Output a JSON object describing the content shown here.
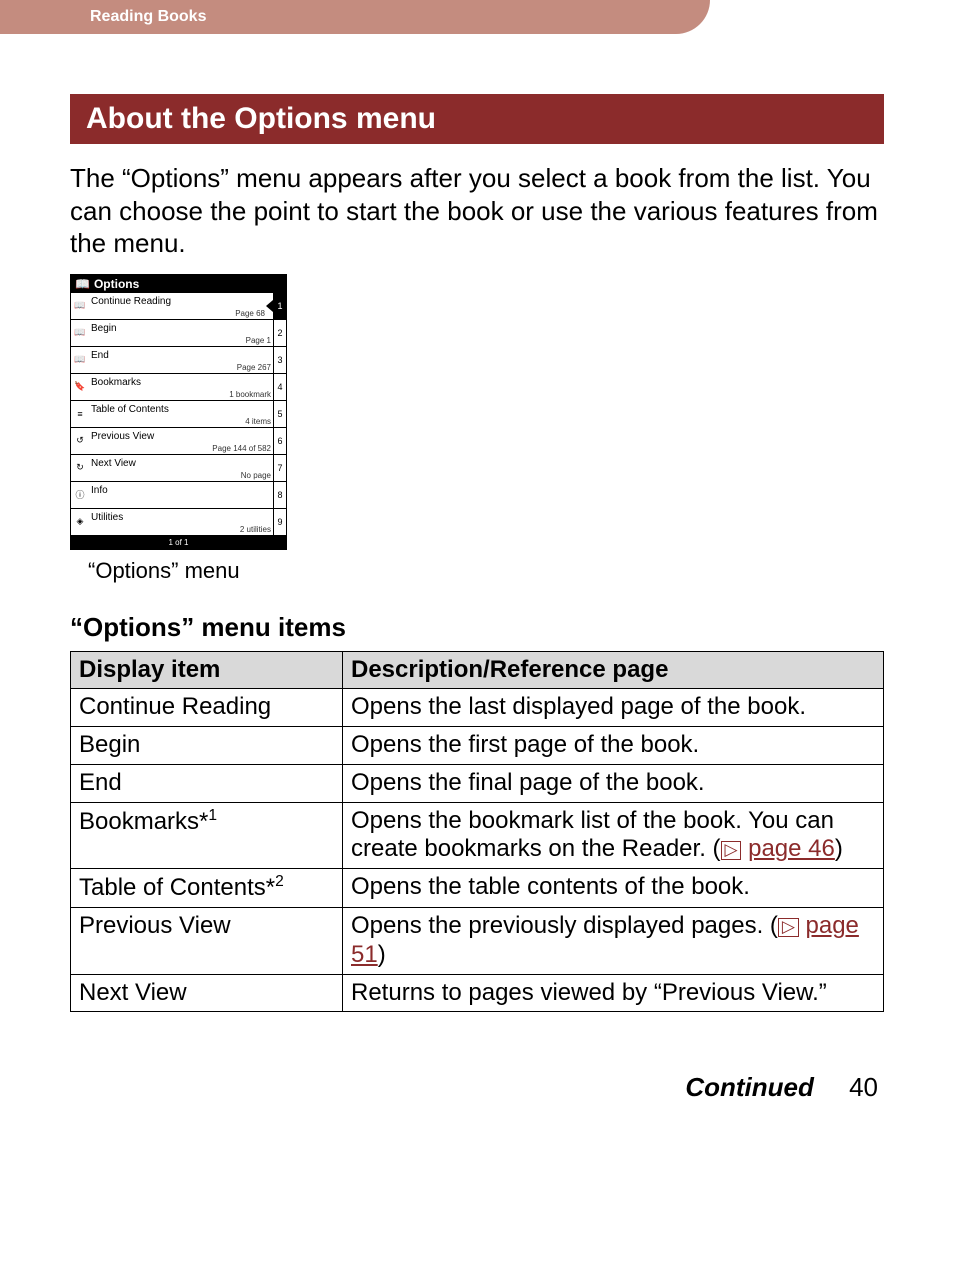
{
  "header": {
    "breadcrumb": "Reading Books"
  },
  "section": {
    "title": "About the Options menu",
    "intro": "The “Options” menu appears after you select a book from the list. You can choose the point to start the book or use the various features from the menu."
  },
  "device": {
    "title": "Options",
    "footer": "1 of 1",
    "rows": [
      {
        "icon": "📖",
        "label": "Continue Reading",
        "sub": "Page 68",
        "num": "1",
        "active": true
      },
      {
        "icon": "📖",
        "label": "Begin",
        "sub": "Page 1",
        "num": "2",
        "active": false
      },
      {
        "icon": "📖",
        "label": "End",
        "sub": "Page 267",
        "num": "3",
        "active": false
      },
      {
        "icon": "🔖",
        "label": "Bookmarks",
        "sub": "1 bookmark",
        "num": "4",
        "active": false
      },
      {
        "icon": "≡",
        "label": "Table of Contents",
        "sub": "4 items",
        "num": "5",
        "active": false
      },
      {
        "icon": "↺",
        "label": "Previous View",
        "sub": "Page 144 of 582",
        "num": "6",
        "active": false
      },
      {
        "icon": "↻",
        "label": "Next View",
        "sub": "No page",
        "num": "7",
        "active": false
      },
      {
        "icon": "ⓘ",
        "label": "Info",
        "sub": "",
        "num": "8",
        "active": false
      },
      {
        "icon": "◈",
        "label": "Utilities",
        "sub": "2 utilities",
        "num": "9",
        "active": false
      }
    ],
    "caption": "“Options” menu"
  },
  "table": {
    "heading": "“Options” menu items",
    "col1": "Display item",
    "col2": "Description/Reference page",
    "rows": [
      {
        "item": "Continue Reading",
        "sup": "",
        "desc_pre": "Opens the last displayed page of the book.",
        "link": "",
        "desc_post": ""
      },
      {
        "item": "Begin",
        "sup": "",
        "desc_pre": "Opens the first page of the book.",
        "link": "",
        "desc_post": ""
      },
      {
        "item": "End",
        "sup": "",
        "desc_pre": "Opens the final page of the book.",
        "link": "",
        "desc_post": ""
      },
      {
        "item": "Bookmarks*",
        "sup": "1",
        "desc_pre": "Opens the bookmark list of the book. You can create bookmarks on the Reader. (",
        "link": "page 46",
        "desc_post": ")"
      },
      {
        "item": "Table of Contents*",
        "sup": "2",
        "desc_pre": "Opens the table contents of the book.",
        "link": "",
        "desc_post": ""
      },
      {
        "item": "Previous View",
        "sup": "",
        "desc_pre": "Opens the previously displayed pages. (",
        "link": "page 51",
        "desc_post": ")"
      },
      {
        "item": "Next View",
        "sup": "",
        "desc_pre": "Returns to pages viewed by “Previous View.”",
        "link": "",
        "desc_post": ""
      }
    ]
  },
  "footer": {
    "continued": "Continued",
    "page": "40"
  },
  "icon_glyph": "▷"
}
